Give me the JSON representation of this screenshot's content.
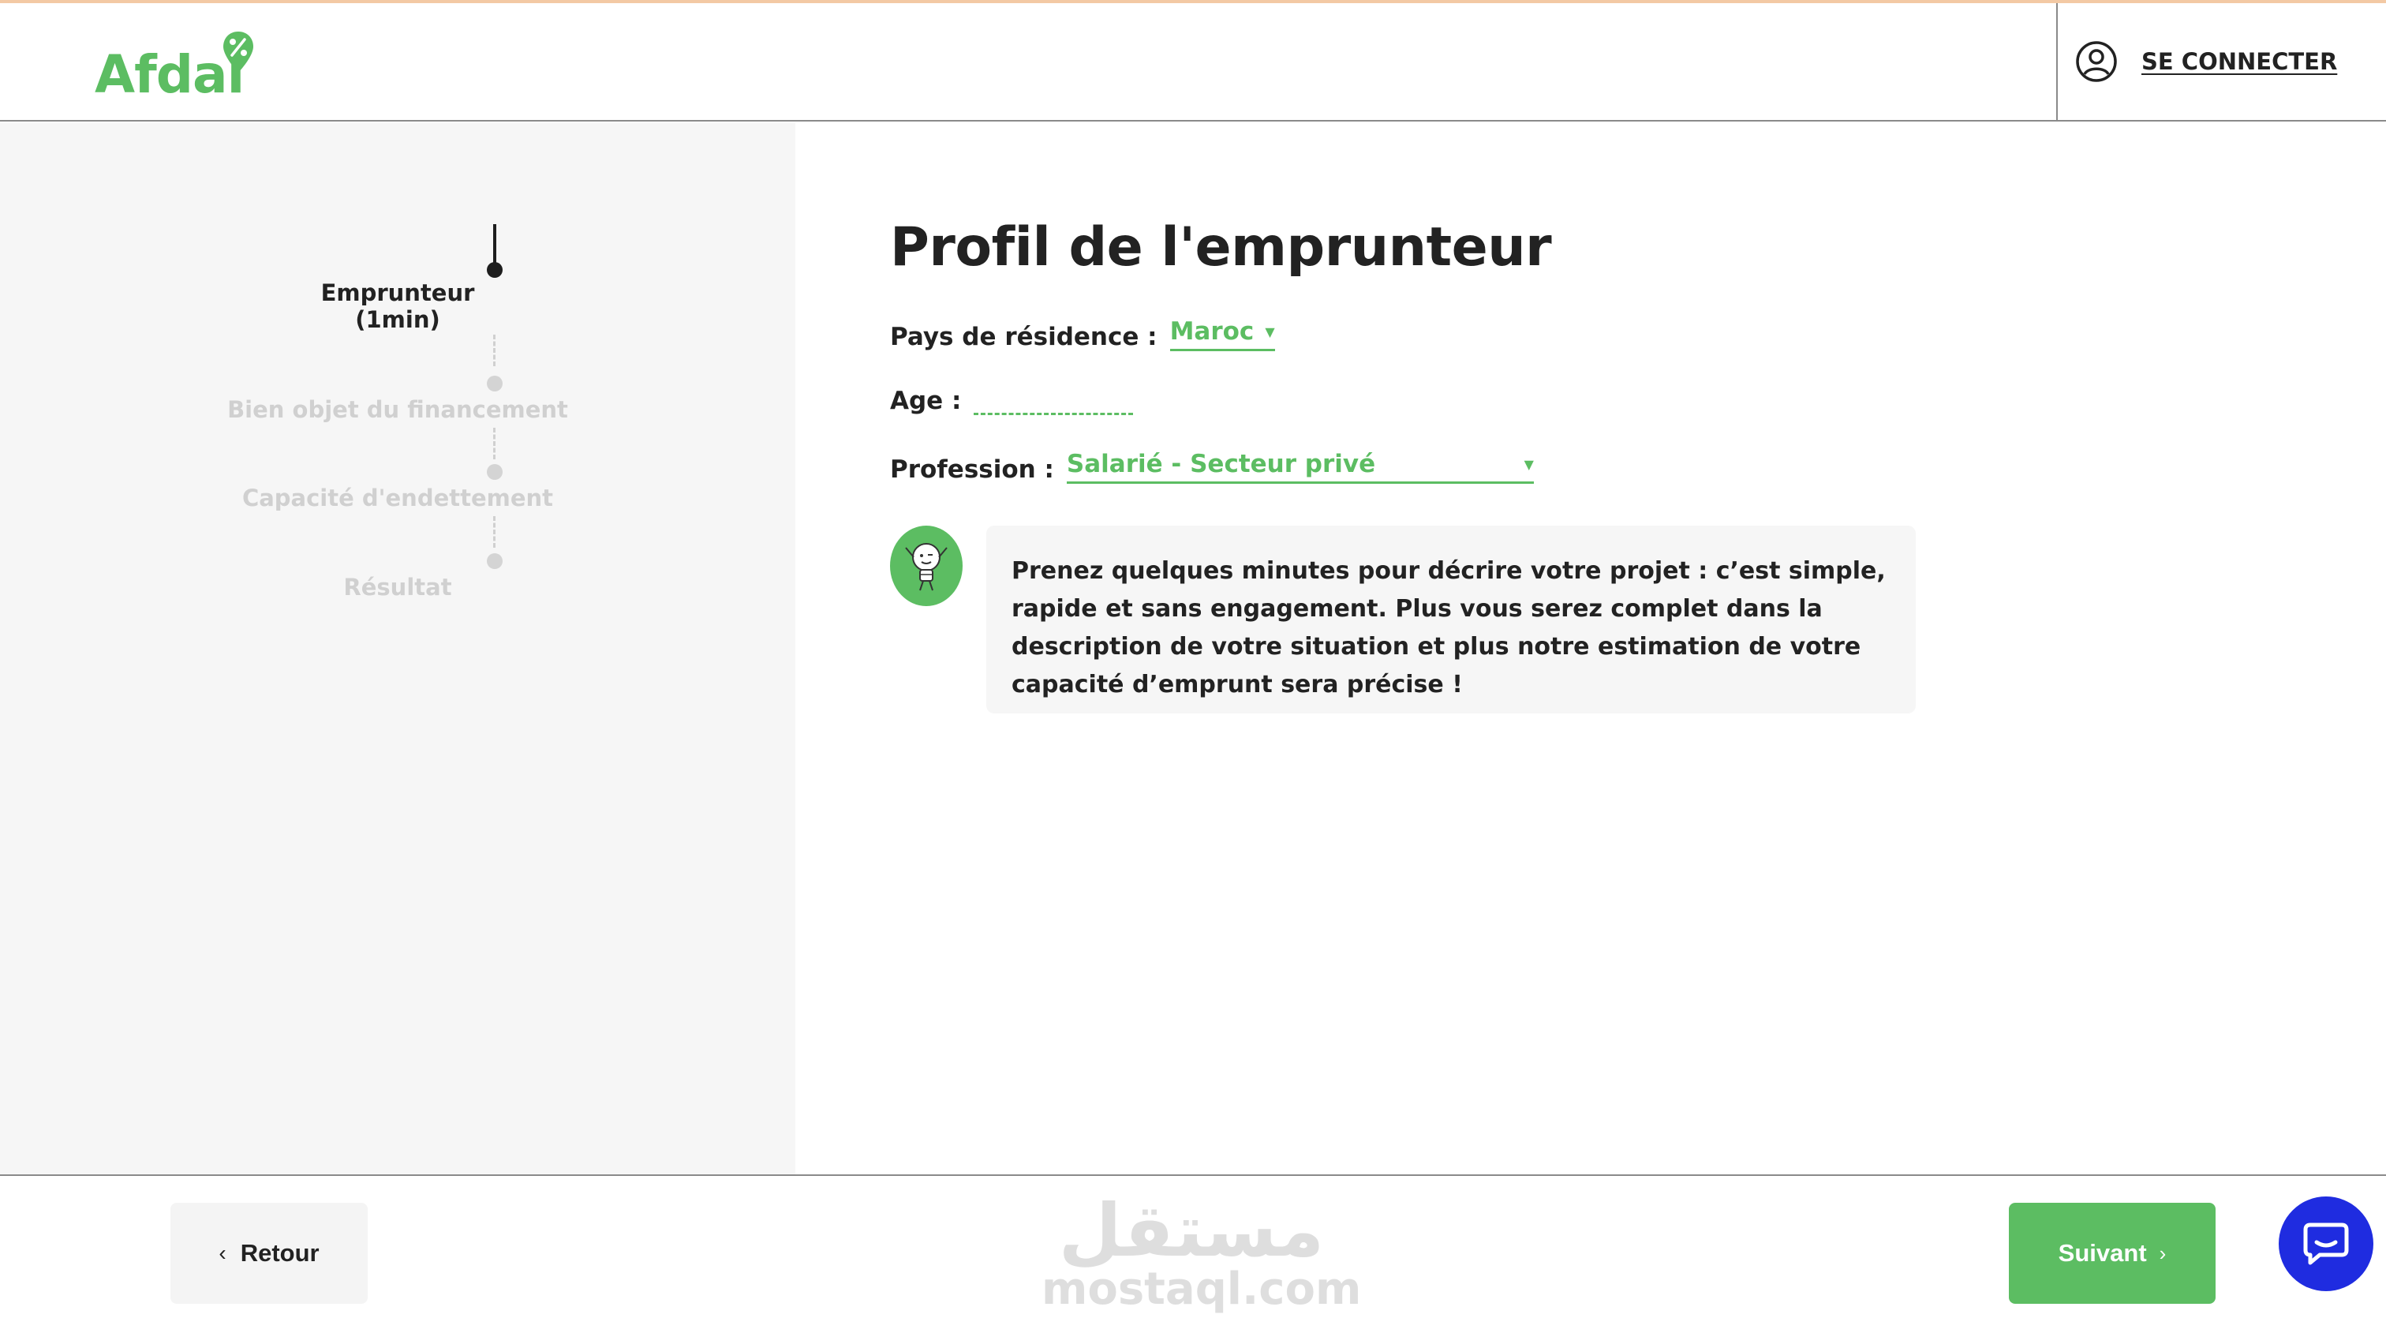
{
  "header": {
    "logo_text": "Afdal",
    "login_label": "SE CONNECTER"
  },
  "sidebar": {
    "steps": [
      {
        "label": "Emprunteur",
        "sub": "(1min)",
        "state": "active"
      },
      {
        "label": "Bien objet du financement",
        "state": "inactive"
      },
      {
        "label": "Capacité d'endettement",
        "state": "inactive"
      },
      {
        "label": "Résultat",
        "state": "inactive"
      }
    ]
  },
  "main": {
    "title": "Profil de l'emprunteur",
    "country": {
      "label": "Pays de résidence :",
      "value": "Maroc"
    },
    "age": {
      "label": "Age :",
      "value": ""
    },
    "profession": {
      "label": "Profession :",
      "value": "Salarié - Secteur privé"
    },
    "info_text": "Prenez quelques minutes pour décrire votre projet : c’est simple, rapide et sans engagement. Plus vous serez complet dans la description de votre situation et plus notre estimation de votre capacité d’emprunt sera précise !"
  },
  "footer": {
    "back_label": "Retour",
    "next_label": "Suivant",
    "chevron_left": "‹",
    "chevron_right": "›"
  },
  "watermark": {
    "arabic": "مستقل",
    "latin": "mostaql.com"
  },
  "colors": {
    "brand_green": "#5cbd62",
    "chat_blue": "#1f2ce0",
    "sidebar_bg": "#f6f6f6"
  },
  "icons": {
    "logo_pin": "percent-pin-icon",
    "login": "user-circle-icon",
    "mascot": "lightbulb-mascot-icon",
    "chat": "chat-bubble-icon"
  }
}
